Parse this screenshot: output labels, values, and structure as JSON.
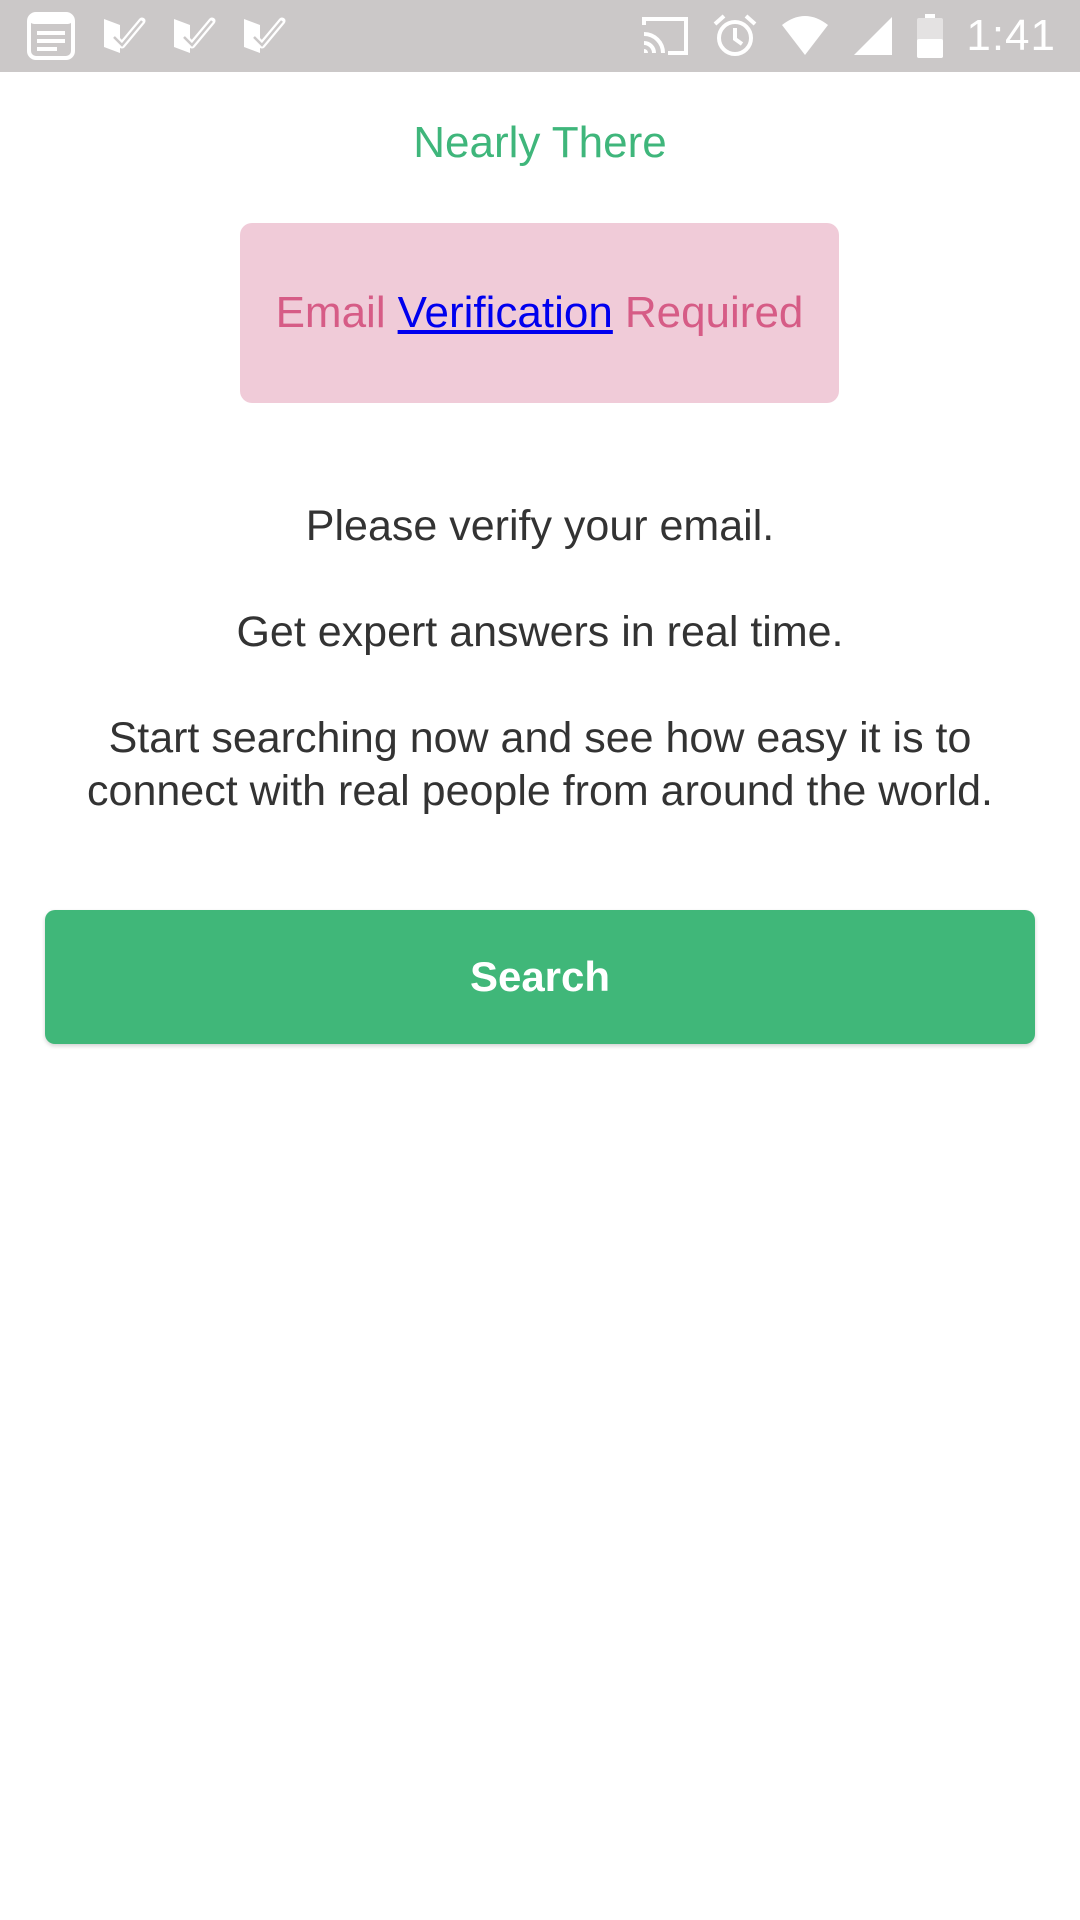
{
  "status_bar": {
    "time": "1:41",
    "left_icons": [
      "notes-icon",
      "check-icon",
      "check-icon",
      "check-icon"
    ],
    "right_icons": [
      "cast-icon",
      "alarm-icon",
      "wifi-icon",
      "signal-icon",
      "battery-icon"
    ]
  },
  "page": {
    "title": "Nearly There",
    "alert": {
      "prefix": "Email",
      "link": "Verification",
      "suffix": "Required"
    },
    "paragraphs": [
      "Please verify your email.",
      "Get expert answers in real time.",
      "Start searching now and see how easy it is to connect with real people from around the world."
    ],
    "search_button_label": "Search"
  },
  "colors": {
    "status_bar": "#cbc8c8",
    "accent_green": "#40b779",
    "alert_bg": "#f0cbd8",
    "alert_text": "#d65c86",
    "link": "#0000ee"
  }
}
